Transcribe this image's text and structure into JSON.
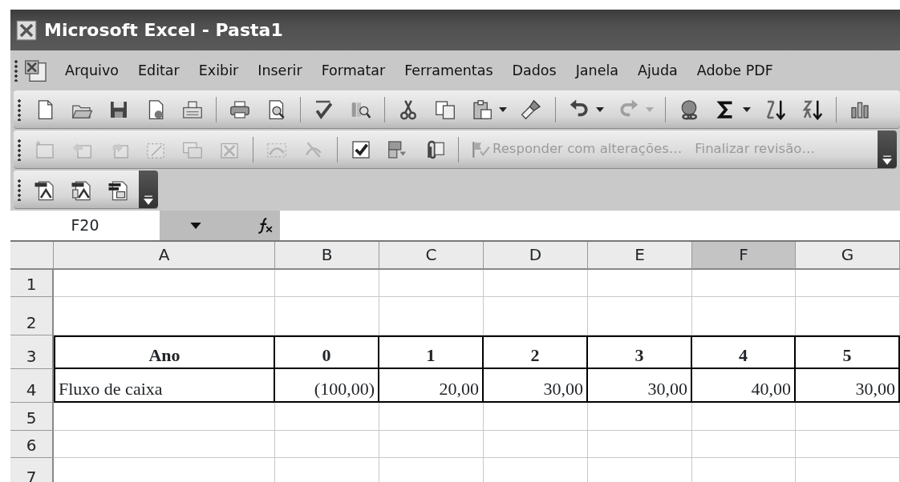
{
  "window": {
    "title": "Microsoft Excel - Pasta1"
  },
  "menu": [
    {
      "label": "Arquivo"
    },
    {
      "label": "Editar"
    },
    {
      "label": "Exibir"
    },
    {
      "label": "Inserir"
    },
    {
      "label": "Formatar"
    },
    {
      "label": "Ferramentas"
    },
    {
      "label": "Dados"
    },
    {
      "label": "Janela"
    },
    {
      "label": "Ajuda"
    },
    {
      "label": "Adobe PDF"
    }
  ],
  "toolbars": [
    {
      "overflow": false,
      "items": [
        {
          "kind": "new"
        },
        {
          "kind": "open"
        },
        {
          "kind": "save"
        },
        {
          "kind": "permission"
        },
        {
          "kind": "email"
        },
        {
          "kind": "separator"
        },
        {
          "kind": "print"
        },
        {
          "kind": "preview"
        },
        {
          "kind": "separator"
        },
        {
          "kind": "spelling"
        },
        {
          "kind": "research"
        },
        {
          "kind": "separator"
        },
        {
          "kind": "cut"
        },
        {
          "kind": "copy"
        },
        {
          "kind": "paste",
          "dropdown": true
        },
        {
          "kind": "brush"
        },
        {
          "kind": "separator"
        },
        {
          "kind": "undo",
          "dropdown": true
        },
        {
          "kind": "redo",
          "dropdown": true,
          "disabled": true
        },
        {
          "kind": "separator"
        },
        {
          "kind": "hyperlink"
        },
        {
          "kind": "sum",
          "dropdown": true
        },
        {
          "kind": "sort-asc"
        },
        {
          "kind": "sort-desc"
        },
        {
          "kind": "separator"
        },
        {
          "kind": "chart"
        }
      ]
    },
    {
      "overflow": true,
      "items": [
        {
          "kind": "comment",
          "disabled": true
        },
        {
          "kind": "prev",
          "disabled": true
        },
        {
          "kind": "next",
          "disabled": true
        },
        {
          "kind": "edit-comment",
          "disabled": true
        },
        {
          "kind": "show-all",
          "disabled": true
        },
        {
          "kind": "delete-comment",
          "disabled": true
        },
        {
          "kind": "separator"
        },
        {
          "kind": "ink",
          "disabled": true
        },
        {
          "kind": "delete-ink",
          "disabled": true
        },
        {
          "kind": "separator"
        },
        {
          "kind": "track"
        },
        {
          "kind": "protect"
        },
        {
          "kind": "attach"
        },
        {
          "kind": "separator"
        },
        {
          "kind": "text",
          "label": "Responder com alterações…",
          "icon": true,
          "disabled": true
        },
        {
          "kind": "text",
          "label": "Finalizar revisão…",
          "disabled": true
        }
      ]
    },
    {
      "overflow": true,
      "items": [
        {
          "kind": "pdf"
        },
        {
          "kind": "pdf-attach"
        },
        {
          "kind": "pdf-review"
        }
      ]
    }
  ],
  "formula_bar": {
    "name_box": "F20"
  },
  "sheet": {
    "columns": [
      {
        "label": "A",
        "selected": false
      },
      {
        "label": "B",
        "selected": false
      },
      {
        "label": "C",
        "selected": false
      },
      {
        "label": "D",
        "selected": false
      },
      {
        "label": "E",
        "selected": false
      },
      {
        "label": "F",
        "selected": true
      },
      {
        "label": "G",
        "selected": false
      }
    ],
    "rows": [
      {
        "header": "1"
      },
      {
        "header": "2"
      },
      {
        "header": "3",
        "bold": true,
        "bordered": true,
        "cells": [
          {
            "text": "Ano",
            "kind": "heading"
          },
          {
            "text": "0",
            "kind": "heading"
          },
          {
            "text": "1",
            "kind": "heading"
          },
          {
            "text": "2",
            "kind": "heading"
          },
          {
            "text": "3",
            "kind": "heading"
          },
          {
            "text": "4",
            "kind": "heading"
          },
          {
            "text": "5",
            "kind": "heading"
          }
        ]
      },
      {
        "header": "4",
        "bold": false,
        "bordered": true,
        "cells": [
          {
            "text": "Fluxo de caixa",
            "kind": "label"
          },
          {
            "text": "(100,00)",
            "kind": "number"
          },
          {
            "text": "20,00",
            "kind": "number"
          },
          {
            "text": "30,00",
            "kind": "number"
          },
          {
            "text": "30,00",
            "kind": "number"
          },
          {
            "text": "40,00",
            "kind": "number"
          },
          {
            "text": "30,00",
            "kind": "number"
          }
        ]
      },
      {
        "header": "5"
      },
      {
        "header": "6"
      },
      {
        "header": "7"
      }
    ]
  }
}
